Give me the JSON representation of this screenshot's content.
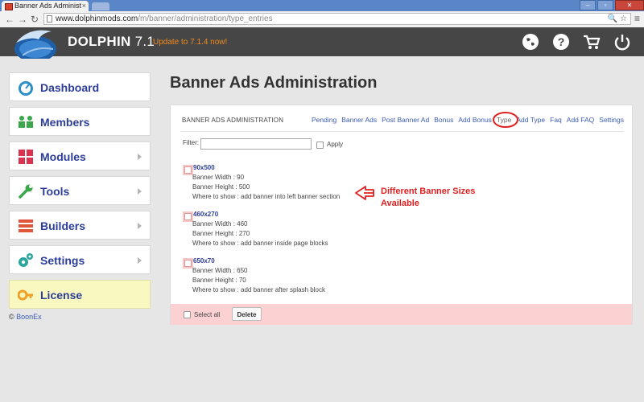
{
  "browser": {
    "tab_title": "Banner Ads Administ",
    "url_domain": "www.dolphinmods.com",
    "url_path": "/m/banner/administration/type_entries"
  },
  "header": {
    "brand": "DOLPHIN",
    "version": "7.1",
    "update_text": "Update to 7.1.4 now!",
    "icons": [
      "globe-icon",
      "help-icon",
      "cart-icon",
      "power-icon"
    ]
  },
  "sidebar": {
    "items": [
      {
        "label": "Dashboard",
        "icon": "dashboard-icon",
        "has_arrow": false
      },
      {
        "label": "Members",
        "icon": "members-icon",
        "has_arrow": false
      },
      {
        "label": "Modules",
        "icon": "modules-icon",
        "has_arrow": true
      },
      {
        "label": "Tools",
        "icon": "wrench-icon",
        "has_arrow": true
      },
      {
        "label": "Builders",
        "icon": "builders-icon",
        "has_arrow": true
      },
      {
        "label": "Settings",
        "icon": "gears-icon",
        "has_arrow": true
      },
      {
        "label": "License",
        "icon": "key-icon",
        "has_arrow": false
      }
    ],
    "footer": {
      "copyright": "©",
      "link": "BoonEx"
    }
  },
  "main": {
    "page_title": "Banner Ads Administration",
    "panel_title": "BANNER ADS ADMINISTRATION",
    "nav": [
      "Pending",
      "Banner Ads",
      "Post Banner Ad",
      "Bonus",
      "Add Bonus",
      "Type",
      "Add Type",
      "Faq",
      "Add FAQ",
      "Settings"
    ],
    "nav_current": "Type",
    "filter_label": "Filter:",
    "filter_value": "",
    "apply_label": "Apply",
    "entries": [
      {
        "title": "90x500",
        "width": "Banner Width : 90",
        "height": "Banner Height : 500",
        "where": "Where to show : add banner into left banner section"
      },
      {
        "title": "460x270",
        "width": "Banner Width : 460",
        "height": "Banner Height : 270",
        "where": "Where to show : add banner inside page blocks"
      },
      {
        "title": "650x70",
        "width": "Banner Width : 650",
        "height": "Banner Height : 70",
        "where": "Where to show : add banner after splash block"
      }
    ],
    "annotation": [
      "Different Banner Sizes",
      "Available"
    ],
    "select_all_label": "Select all",
    "delete_label": "Delete"
  },
  "colors": {
    "accent": "#2c3e9a",
    "annotation": "#e02020",
    "header_bg": "#464646",
    "bottom_bar": "#fbd1d1",
    "license_bg": "#f8f8c0"
  }
}
